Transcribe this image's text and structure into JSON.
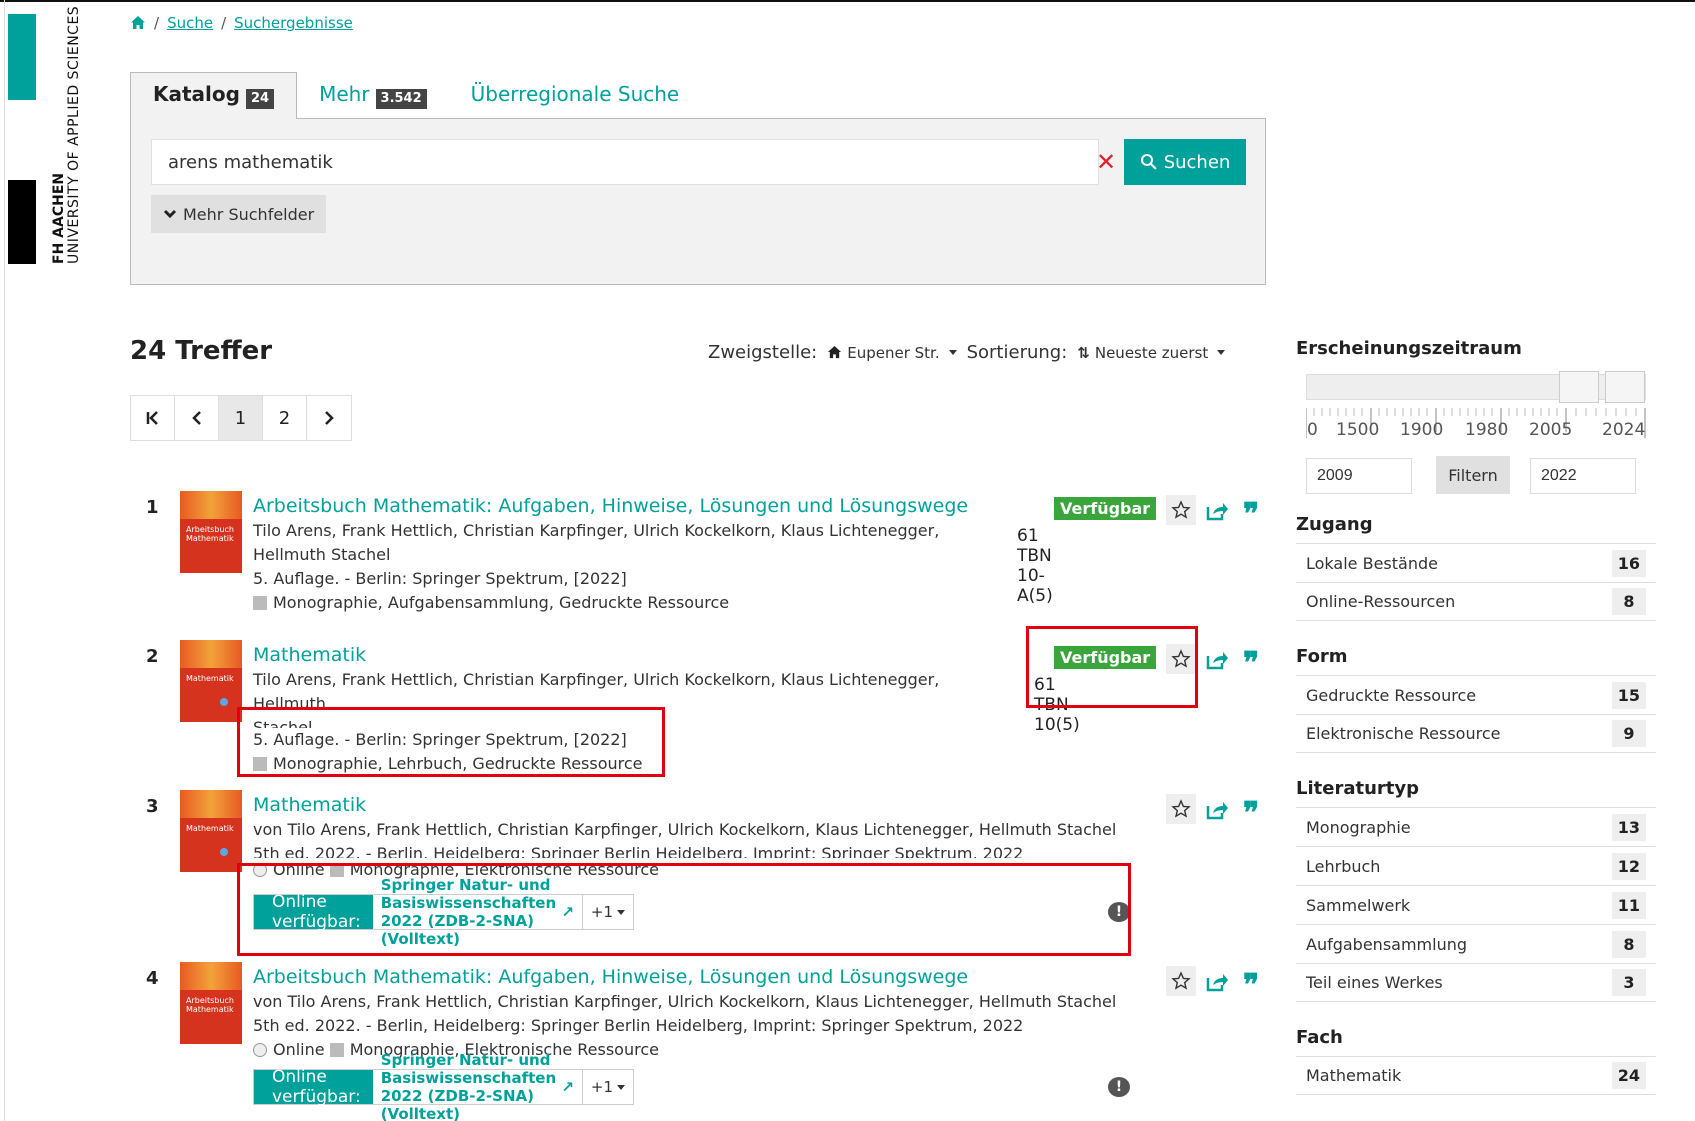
{
  "logo": {
    "line1": "FH AACHEN",
    "line2": "UNIVERSITY OF APPLIED SCIENCES"
  },
  "breadcrumb": {
    "items": [
      "Suche",
      "Suchergebnisse"
    ]
  },
  "tabs": [
    {
      "label": "Katalog",
      "count": "24"
    },
    {
      "label": "Mehr",
      "count": "3.542"
    },
    {
      "label": "Überregionale Suche"
    }
  ],
  "search": {
    "value": "arens mathematik",
    "button": "Suchen",
    "more_fields": "Mehr Suchfelder"
  },
  "results_header": {
    "hits": "24 Treffer",
    "branch_label": "Zweigstelle:",
    "branch_value": "Eupener Str.",
    "sort_label": "Sortierung:",
    "sort_value": "Neueste zuerst"
  },
  "pagination": {
    "pages": [
      "1",
      "2"
    ]
  },
  "results": [
    {
      "num": "1",
      "cover": "Arbeitsbuch Mathematik",
      "title": "Arbeitsbuch Mathematik: Aufgaben, Hinweise, Lösungen und Lösungswege",
      "authors": "Tilo Arens, Frank Hettlich, Christian Karpfinger, Ulrich Kockelkorn, Klaus Lichtenegger,",
      "authors2": "Hellmuth Stachel",
      "edition": "5. Auflage. - Berlin: Springer Spektrum, [2022]",
      "format": "Monographie, Aufgabensammlung, Gedruckte Ressource",
      "availability": "Verfügbar",
      "signature": "61 TBN 10-A(5)"
    },
    {
      "num": "2",
      "cover": "Mathematik",
      "title": "Mathematik",
      "authors": "Tilo Arens, Frank Hettlich, Christian Karpfinger, Ulrich Kockelkorn, Klaus Lichtenegger, Hellmuth",
      "authors2": "Stachel",
      "edition": "5. Auflage. - Berlin: Springer Spektrum, [2022]",
      "format": "Monographie, Lehrbuch, Gedruckte Ressource",
      "availability": "Verfügbar",
      "signature": "61 TBN 10(5)"
    },
    {
      "num": "3",
      "cover": "Mathematik",
      "title": "Mathematik",
      "authors": "von Tilo Arens, Frank Hettlich, Christian Karpfinger, Ulrich Kockelkorn, Klaus Lichtenegger, Hellmuth Stachel",
      "edition": "5th ed. 2022. - Berlin, Heidelberg: Springer Berlin Heidelberg, Imprint: Springer Spektrum, 2022",
      "online": "Online",
      "format": "Monographie, Elektronische Ressource",
      "online_label": "Online verfügbar:",
      "online_link": "Springer Natur- und Basiswissenschaften 2022 (ZDB-2-SNA) (Volltext)",
      "online_more": "+1"
    },
    {
      "num": "4",
      "cover": "Arbeitsbuch Mathematik",
      "title": "Arbeitsbuch Mathematik: Aufgaben, Hinweise, Lösungen und Lösungswege",
      "authors": "von Tilo Arens, Frank Hettlich, Christian Karpfinger, Ulrich Kockelkorn, Klaus Lichtenegger, Hellmuth Stachel",
      "edition": "5th ed. 2022. - Berlin, Heidelberg: Springer Berlin Heidelberg, Imprint: Springer Spektrum, 2022",
      "online": "Online",
      "format": "Monographie, Elektronische Ressource",
      "online_label": "Online verfügbar:",
      "online_link": "Springer Natur- und Basiswissenschaften 2022 (ZDB-2-SNA) (Volltext)",
      "online_more": "+1"
    }
  ],
  "sidebar": {
    "period": {
      "title": "Erscheinungszeitraum",
      "ticks": [
        "0",
        "1500",
        "1900",
        "1980",
        "2005",
        "2024"
      ],
      "from": "2009",
      "to": "2022",
      "filter": "Filtern"
    },
    "facets": [
      {
        "title": "Zugang",
        "rows": [
          {
            "label": "Lokale Bestände",
            "count": "16"
          },
          {
            "label": "Online-Ressourcen",
            "count": "8"
          }
        ]
      },
      {
        "title": "Form",
        "rows": [
          {
            "label": "Gedruckte Ressource",
            "count": "15"
          },
          {
            "label": "Elektronische Ressource",
            "count": "9"
          }
        ]
      },
      {
        "title": "Literaturtyp",
        "rows": [
          {
            "label": "Monographie",
            "count": "13"
          },
          {
            "label": "Lehrbuch",
            "count": "12"
          },
          {
            "label": "Sammelwerk",
            "count": "11"
          },
          {
            "label": "Aufgabensammlung",
            "count": "8"
          },
          {
            "label": "Teil eines Werkes",
            "count": "3"
          }
        ]
      },
      {
        "title": "Fach",
        "rows": [
          {
            "label": "Mathematik",
            "count": "24"
          }
        ]
      }
    ]
  },
  "colors": {
    "accent": "#00a19a",
    "available": "#3aa53a",
    "highlight": "#e0000f"
  }
}
